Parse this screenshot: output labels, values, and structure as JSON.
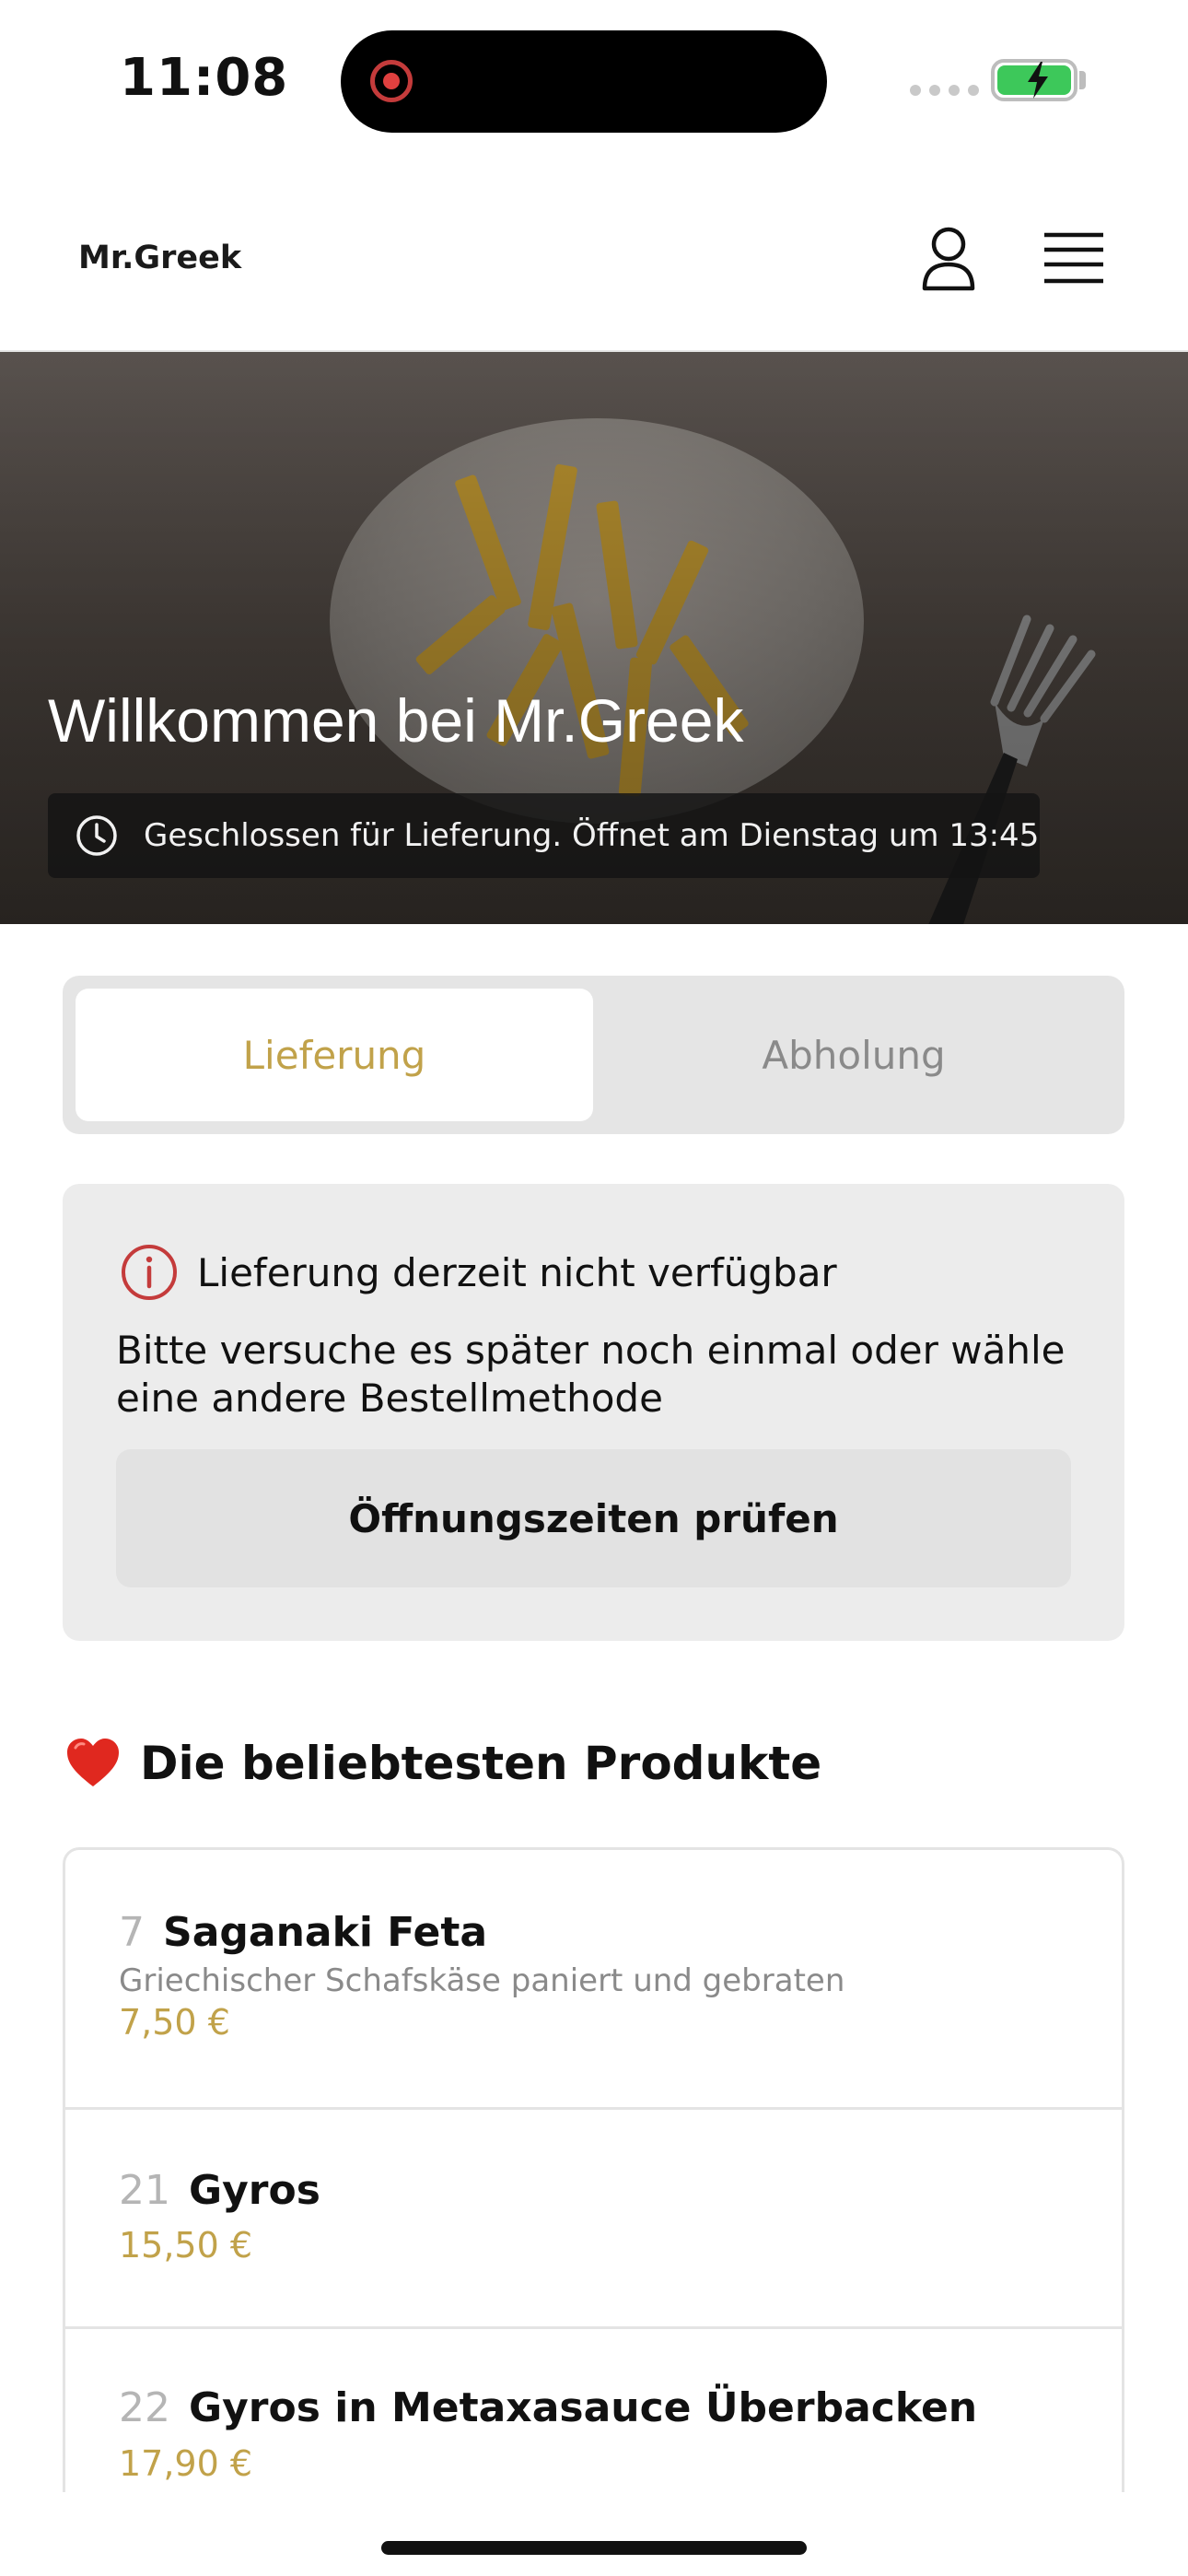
{
  "status_bar": {
    "time": "11:08"
  },
  "header": {
    "brand": "Mr.Greek",
    "icons": [
      "user-icon",
      "menu-icon"
    ]
  },
  "hero": {
    "title": "Willkommen bei Mr.Greek",
    "status_text": "Geschlossen für Lieferung. Öffnet am Dienstag um 13:45"
  },
  "tabs": [
    {
      "label": "Lieferung",
      "active": true
    },
    {
      "label": "Abholung",
      "active": false
    }
  ],
  "notice": {
    "title": "Lieferung derzeit nicht verfügbar",
    "body": "Bitte versuche es später noch einmal oder wähle eine andere Bestellmethode",
    "button_label": "Öffnungszeiten prüfen"
  },
  "popular": {
    "title": "Die beliebtesten Produkte",
    "products": [
      {
        "number": "7",
        "name": "Saganaki Feta",
        "description": "Griechischer Schafskäse paniert und gebraten",
        "price": "7,50 €"
      },
      {
        "number": "21",
        "name": "Gyros",
        "price": "15,50 €"
      },
      {
        "number": "22",
        "name": "Gyros in Metaxasauce Überbacken",
        "price": "17,90 €"
      }
    ]
  },
  "colors": {
    "accent": "#c1a24a",
    "info_red": "#c43b3b",
    "battery_green": "#3dc85a"
  }
}
